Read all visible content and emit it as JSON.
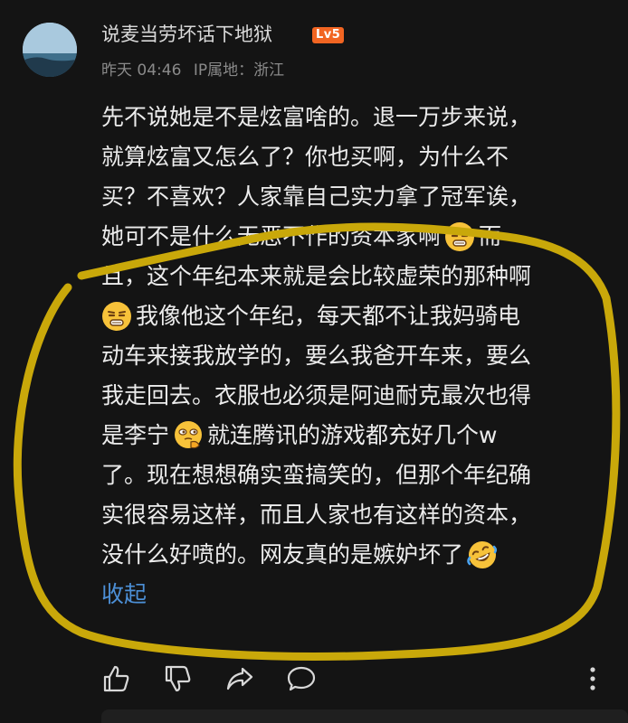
{
  "comment": {
    "username": "说麦当劳坏话下地狱",
    "level_badge": "Lv5",
    "time": "昨天 04:46",
    "ip_location": "IP属地：浙江",
    "lines": [
      "先不说她是不是炫富啥的。退一万步来说，",
      "就算炫富又怎么了？你也买啊，为什么不",
      "买？不喜欢？人家靠自己实力拿了冠军诶，",
      "她可不是什么无恶不作的资本家啊",
      "而",
      "且，这个年纪本来就是会比较虚荣的那种啊",
      "我像他这个年纪，每天都不让我妈骑电",
      "动车来接我放学的，要么我爸开车来，要么",
      "我走回去。衣服也必须是阿迪耐克最次也得",
      "是李宁",
      "就连腾讯的游戏都充好几个w",
      "了。现在想想确实蛮搞笑的，但那个年纪确",
      "实很容易这样，而且人家也有这样的资本，",
      "没什么好喷的。网友真的是嫉妒坏了"
    ],
    "collapse_label": "收起"
  },
  "colors": {
    "background": "#141414",
    "link": "#4c8fd6",
    "highlight_circle": "#c9a80a",
    "level_badge": "#f26522"
  },
  "icons": [
    "like-icon",
    "dislike-icon",
    "share-icon",
    "comment-icon",
    "more-icon"
  ]
}
